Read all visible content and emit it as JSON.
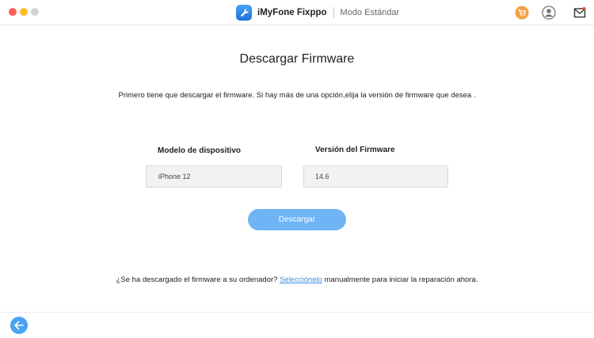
{
  "window": {
    "app_name": "iMyFone Fixppo",
    "mode": "Modo Estándar"
  },
  "header_icons": {
    "cart": "cart-icon",
    "user": "user-icon",
    "mail": "mail-icon"
  },
  "main": {
    "title": "Descargar Firmware",
    "instructions": "Primero tiene que descargar el firmware. Si hay más de una opción,elija la versión de firmware que desea .",
    "model_label": "Modelo de dispositivo",
    "model_value": "iPhone 12",
    "firmware_label": "Versión del Firmware",
    "firmware_value": "14.6",
    "download_label": "Descargar"
  },
  "footer": {
    "note_before": "¿Se ha descargado el firmware a su ordenador? ",
    "link_text": "Selecciónelo",
    "note_after": " manualmente para iniciar la reparación ahora."
  },
  "colors": {
    "accent": "#6fb4f5",
    "link": "#3a8fe6",
    "cart_icon": "#f5a043",
    "back_button": "#4aa3f2"
  }
}
